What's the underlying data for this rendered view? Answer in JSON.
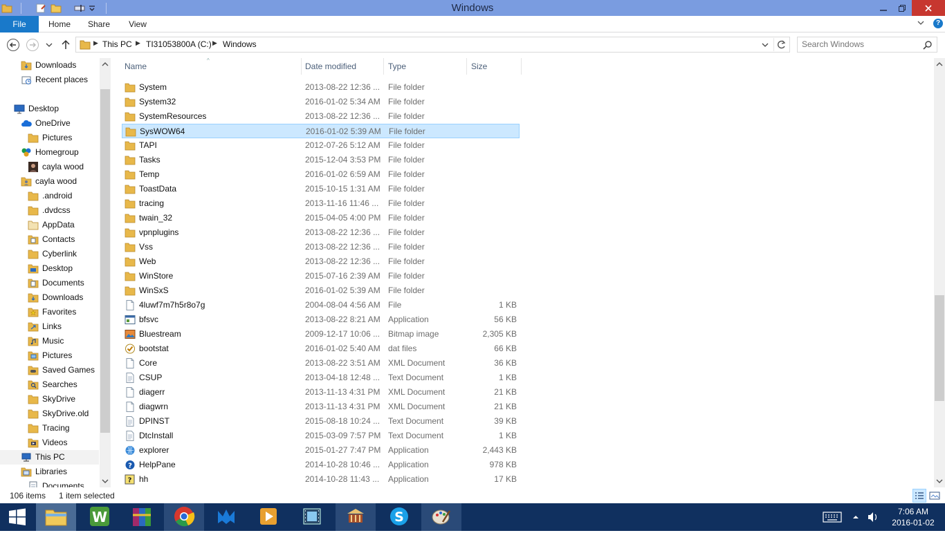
{
  "window": {
    "title": "Windows"
  },
  "ribbon": {
    "tabs": [
      "File",
      "Home",
      "Share",
      "View"
    ]
  },
  "address": {
    "crumbs": [
      "This PC",
      "TI31053800A (C:)",
      "Windows"
    ],
    "search_placeholder": "Search Windows"
  },
  "nav_pane": {
    "items": [
      {
        "label": "Downloads",
        "icon": "download-folder-icon",
        "indent": 1
      },
      {
        "label": "Recent places",
        "icon": "recent-places-icon",
        "indent": 1
      },
      {
        "label": "Desktop",
        "icon": "desktop-icon",
        "indent": 0
      },
      {
        "label": "OneDrive",
        "icon": "onedrive-icon",
        "indent": 1
      },
      {
        "label": "Pictures",
        "icon": "folder-icon",
        "indent": 2
      },
      {
        "label": "Homegroup",
        "icon": "homegroup-icon",
        "indent": 1
      },
      {
        "label": "cayla wood",
        "icon": "user-avatar-icon",
        "indent": 2
      },
      {
        "label": "cayla wood",
        "icon": "user-folder-icon",
        "indent": 1
      },
      {
        "label": ".android",
        "icon": "folder-icon",
        "indent": 2
      },
      {
        "label": ".dvdcss",
        "icon": "folder-icon",
        "indent": 2
      },
      {
        "label": "AppData",
        "icon": "hidden-folder-icon",
        "indent": 2
      },
      {
        "label": "Contacts",
        "icon": "contacts-folder-icon",
        "indent": 2
      },
      {
        "label": "Cyberlink",
        "icon": "folder-icon",
        "indent": 2
      },
      {
        "label": "Desktop",
        "icon": "desktop-folder-icon",
        "indent": 2
      },
      {
        "label": "Documents",
        "icon": "documents-folder-icon",
        "indent": 2
      },
      {
        "label": "Downloads",
        "icon": "download-folder-icon",
        "indent": 2
      },
      {
        "label": "Favorites",
        "icon": "favorites-folder-icon",
        "indent": 2
      },
      {
        "label": "Links",
        "icon": "links-folder-icon",
        "indent": 2
      },
      {
        "label": "Music",
        "icon": "music-folder-icon",
        "indent": 2
      },
      {
        "label": "Pictures",
        "icon": "pictures-folder-icon",
        "indent": 2
      },
      {
        "label": "Saved Games",
        "icon": "saved-games-folder-icon",
        "indent": 2
      },
      {
        "label": "Searches",
        "icon": "searches-folder-icon",
        "indent": 2
      },
      {
        "label": "SkyDrive",
        "icon": "folder-icon",
        "indent": 2
      },
      {
        "label": "SkyDrive.old",
        "icon": "folder-icon",
        "indent": 2
      },
      {
        "label": "Tracing",
        "icon": "folder-icon",
        "indent": 2
      },
      {
        "label": "Videos",
        "icon": "videos-folder-icon",
        "indent": 2
      },
      {
        "label": "This PC",
        "icon": "this-pc-icon",
        "indent": 1,
        "selected": true
      },
      {
        "label": "Libraries",
        "icon": "libraries-icon",
        "indent": 1
      },
      {
        "label": "Documents",
        "icon": "documents-library-icon",
        "indent": 2
      }
    ]
  },
  "columns": {
    "name": "Name",
    "date": "Date modified",
    "type": "Type",
    "size": "Size"
  },
  "files": [
    {
      "name": "System",
      "date": "2013-08-22 12:36 ...",
      "type": "File folder",
      "size": "",
      "icon": "folder-icon"
    },
    {
      "name": "System32",
      "date": "2016-01-02 5:34 AM",
      "type": "File folder",
      "size": "",
      "icon": "folder-icon"
    },
    {
      "name": "SystemResources",
      "date": "2013-08-22 12:36 ...",
      "type": "File folder",
      "size": "",
      "icon": "folder-icon"
    },
    {
      "name": "SysWOW64",
      "date": "2016-01-02 5:39 AM",
      "type": "File folder",
      "size": "",
      "icon": "folder-icon",
      "selected": true
    },
    {
      "name": "TAPI",
      "date": "2012-07-26 5:12 AM",
      "type": "File folder",
      "size": "",
      "icon": "folder-icon"
    },
    {
      "name": "Tasks",
      "date": "2015-12-04 3:53 PM",
      "type": "File folder",
      "size": "",
      "icon": "folder-icon"
    },
    {
      "name": "Temp",
      "date": "2016-01-02 6:59 AM",
      "type": "File folder",
      "size": "",
      "icon": "folder-icon"
    },
    {
      "name": "ToastData",
      "date": "2015-10-15 1:31 AM",
      "type": "File folder",
      "size": "",
      "icon": "folder-icon"
    },
    {
      "name": "tracing",
      "date": "2013-11-16 11:46 ...",
      "type": "File folder",
      "size": "",
      "icon": "folder-icon"
    },
    {
      "name": "twain_32",
      "date": "2015-04-05 4:00 PM",
      "type": "File folder",
      "size": "",
      "icon": "folder-icon"
    },
    {
      "name": "vpnplugins",
      "date": "2013-08-22 12:36 ...",
      "type": "File folder",
      "size": "",
      "icon": "folder-icon"
    },
    {
      "name": "Vss",
      "date": "2013-08-22 12:36 ...",
      "type": "File folder",
      "size": "",
      "icon": "folder-icon"
    },
    {
      "name": "Web",
      "date": "2013-08-22 12:36 ...",
      "type": "File folder",
      "size": "",
      "icon": "folder-icon"
    },
    {
      "name": "WinStore",
      "date": "2015-07-16 2:39 AM",
      "type": "File folder",
      "size": "",
      "icon": "folder-icon"
    },
    {
      "name": "WinSxS",
      "date": "2016-01-02 5:39 AM",
      "type": "File folder",
      "size": "",
      "icon": "folder-icon"
    },
    {
      "name": "4luwf7m7h5r8o7g",
      "date": "2004-08-04 4:56 AM",
      "type": "File",
      "size": "1 KB",
      "icon": "file-icon"
    },
    {
      "name": "bfsvc",
      "date": "2013-08-22 8:21 AM",
      "type": "Application",
      "size": "56 KB",
      "icon": "application-icon"
    },
    {
      "name": "Bluestream",
      "date": "2009-12-17 10:06 ...",
      "type": "Bitmap image",
      "size": "2,305 KB",
      "icon": "bitmap-icon"
    },
    {
      "name": "bootstat",
      "date": "2016-01-02 5:40 AM",
      "type": "dat files",
      "size": "66 KB",
      "icon": "checkmark-file-icon"
    },
    {
      "name": "Core",
      "date": "2013-08-22 3:51 AM",
      "type": "XML Document",
      "size": "36 KB",
      "icon": "file-icon"
    },
    {
      "name": "CSUP",
      "date": "2013-04-18 12:48 ...",
      "type": "Text Document",
      "size": "1 KB",
      "icon": "text-file-icon"
    },
    {
      "name": "diagerr",
      "date": "2013-11-13 4:31 PM",
      "type": "XML Document",
      "size": "21 KB",
      "icon": "file-icon"
    },
    {
      "name": "diagwrn",
      "date": "2013-11-13 4:31 PM",
      "type": "XML Document",
      "size": "21 KB",
      "icon": "file-icon"
    },
    {
      "name": "DPINST",
      "date": "2015-08-18 10:24 ...",
      "type": "Text Document",
      "size": "39 KB",
      "icon": "text-file-icon"
    },
    {
      "name": "DtcInstall",
      "date": "2015-03-09 7:57 PM",
      "type": "Text Document",
      "size": "1 KB",
      "icon": "text-file-icon"
    },
    {
      "name": "explorer",
      "date": "2015-01-27 7:47 PM",
      "type": "Application",
      "size": "2,443 KB",
      "icon": "explorer-app-icon"
    },
    {
      "name": "HelpPane",
      "date": "2014-10-28 10:46 ...",
      "type": "Application",
      "size": "978 KB",
      "icon": "help-icon"
    },
    {
      "name": "hh",
      "date": "2014-10-28 11:43 ...",
      "type": "Application",
      "size": "17 KB",
      "icon": "help-file-icon"
    }
  ],
  "status": {
    "item_count": "106 items",
    "selection": "1 item selected"
  },
  "taskbar": {
    "apps": [
      "file-explorer-icon",
      "wordperfect-icon",
      "winrar-icon",
      "chrome-icon",
      "malwarebytes-icon",
      "media-player-icon",
      "video-editor-icon",
      "library-icon",
      "skype-icon",
      "paint-icon"
    ],
    "time": "7:06 AM",
    "date": "2016-01-02"
  },
  "colors": {
    "titlebar": "#7a9ce0",
    "file_tab": "#1979ca",
    "close": "#c7372f",
    "taskbar": "#10305f",
    "selection": "#cce8ff",
    "folder": "#e8b84a"
  }
}
